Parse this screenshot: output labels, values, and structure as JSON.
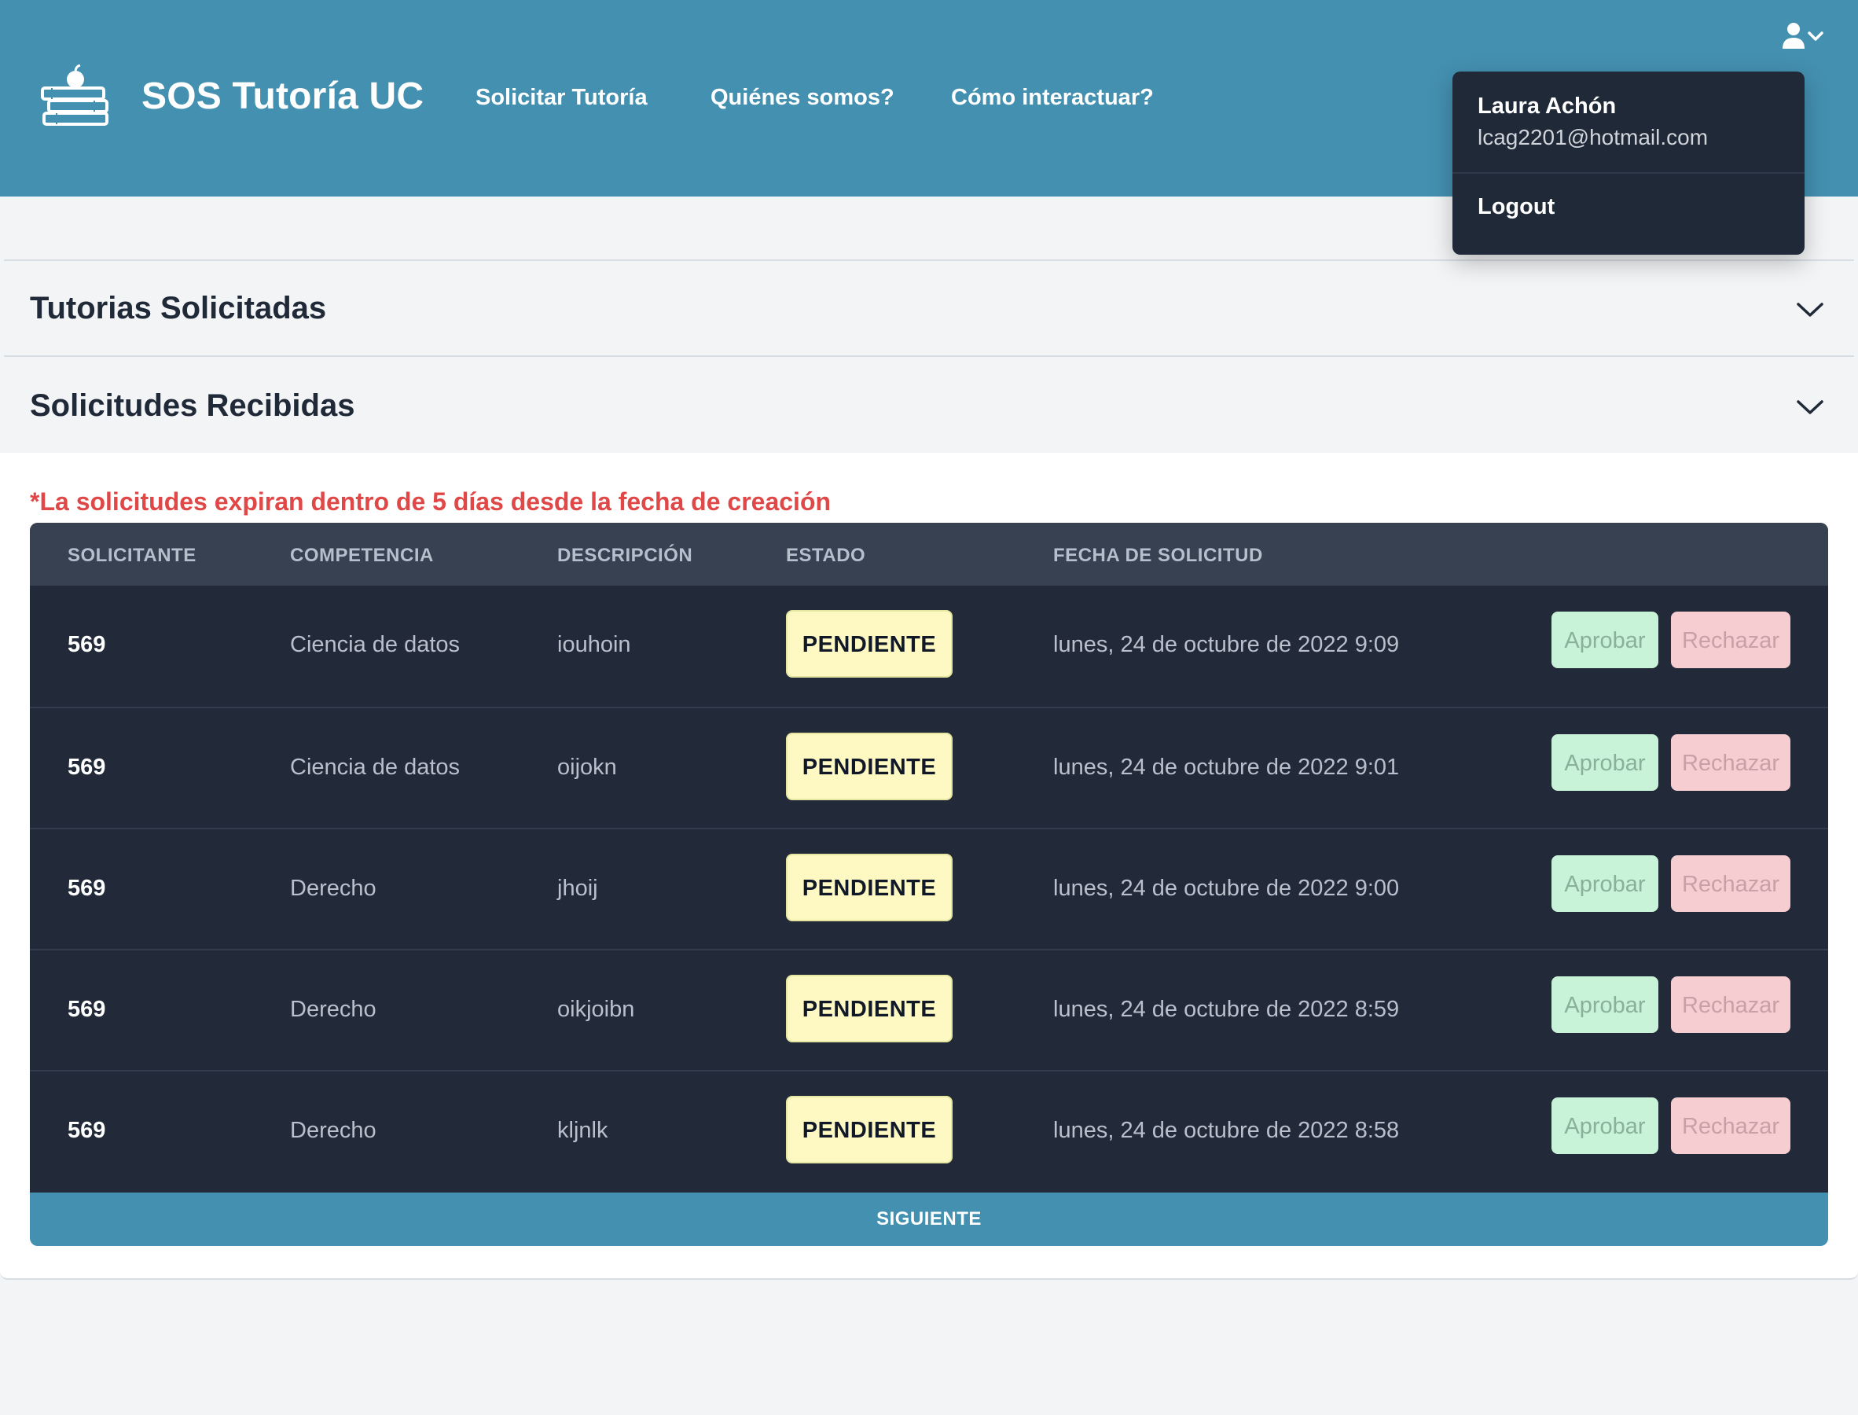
{
  "header": {
    "brand": "SOS Tutoría UC",
    "nav": [
      "Solicitar Tutoría",
      "Quiénes somos?",
      "Cómo interactuar?"
    ],
    "icon": "user-icon"
  },
  "user_menu": {
    "name": "Laura Achón",
    "email": "lcag2201@hotmail.com",
    "logout": "Logout"
  },
  "sections": [
    {
      "title": "Tutorias Solicitadas"
    },
    {
      "title": "Solicitudes Recibidas"
    }
  ],
  "received": {
    "warning": "*La solicitudes expiran dentro de 5 días desde la fecha de creación",
    "columns": [
      "SOLICITANTE",
      "COMPETENCIA",
      "DESCRIPCIÓN",
      "ESTADO",
      "FECHA DE SOLICITUD"
    ],
    "rows": [
      {
        "solicitante": "569",
        "competencia": "Ciencia de datos",
        "descripcion": "iouhoin",
        "estado": "PENDIENTE",
        "fecha": "lunes, 24 de octubre de 2022 9:09",
        "approve": "Aprobar",
        "reject": "Rechazar"
      },
      {
        "solicitante": "569",
        "competencia": "Ciencia de datos",
        "descripcion": "oijokn",
        "estado": "PENDIENTE",
        "fecha": "lunes, 24 de octubre de 2022 9:01",
        "approve": "Aprobar",
        "reject": "Rechazar"
      },
      {
        "solicitante": "569",
        "competencia": "Derecho",
        "descripcion": "jhoij",
        "estado": "PENDIENTE",
        "fecha": "lunes, 24 de octubre de 2022 9:00",
        "approve": "Aprobar",
        "reject": "Rechazar"
      },
      {
        "solicitante": "569",
        "competencia": "Derecho",
        "descripcion": "oikjoibn",
        "estado": "PENDIENTE",
        "fecha": "lunes, 24 de octubre de 2022 8:59",
        "approve": "Aprobar",
        "reject": "Rechazar"
      },
      {
        "solicitante": "569",
        "competencia": "Derecho",
        "descripcion": "kljnlk",
        "estado": "PENDIENTE",
        "fecha": "lunes, 24 de octubre de 2022 8:58",
        "approve": "Aprobar",
        "reject": "Rechazar"
      }
    ],
    "next": "SIGUIENTE"
  },
  "colors": {
    "header": "#4490b0",
    "table": "#222938",
    "warning": "#e04848",
    "badge": "#fef9c3",
    "approve": "#c8f3d8",
    "reject": "#f6cdd0"
  }
}
